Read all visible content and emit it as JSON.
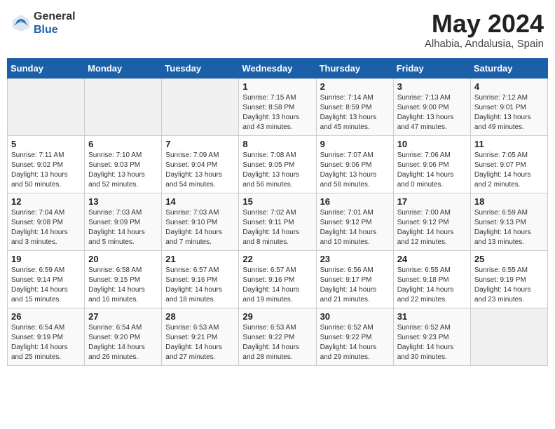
{
  "header": {
    "logo_general": "General",
    "logo_blue": "Blue",
    "month_title": "May 2024",
    "location": "Alhabia, Andalusia, Spain"
  },
  "days_of_week": [
    "Sunday",
    "Monday",
    "Tuesday",
    "Wednesday",
    "Thursday",
    "Friday",
    "Saturday"
  ],
  "weeks": [
    [
      {
        "day": "",
        "info": ""
      },
      {
        "day": "",
        "info": ""
      },
      {
        "day": "",
        "info": ""
      },
      {
        "day": "1",
        "info": "Sunrise: 7:15 AM\nSunset: 8:58 PM\nDaylight: 13 hours\nand 43 minutes."
      },
      {
        "day": "2",
        "info": "Sunrise: 7:14 AM\nSunset: 8:59 PM\nDaylight: 13 hours\nand 45 minutes."
      },
      {
        "day": "3",
        "info": "Sunrise: 7:13 AM\nSunset: 9:00 PM\nDaylight: 13 hours\nand 47 minutes."
      },
      {
        "day": "4",
        "info": "Sunrise: 7:12 AM\nSunset: 9:01 PM\nDaylight: 13 hours\nand 49 minutes."
      }
    ],
    [
      {
        "day": "5",
        "info": "Sunrise: 7:11 AM\nSunset: 9:02 PM\nDaylight: 13 hours\nand 50 minutes."
      },
      {
        "day": "6",
        "info": "Sunrise: 7:10 AM\nSunset: 9:03 PM\nDaylight: 13 hours\nand 52 minutes."
      },
      {
        "day": "7",
        "info": "Sunrise: 7:09 AM\nSunset: 9:04 PM\nDaylight: 13 hours\nand 54 minutes."
      },
      {
        "day": "8",
        "info": "Sunrise: 7:08 AM\nSunset: 9:05 PM\nDaylight: 13 hours\nand 56 minutes."
      },
      {
        "day": "9",
        "info": "Sunrise: 7:07 AM\nSunset: 9:06 PM\nDaylight: 13 hours\nand 58 minutes."
      },
      {
        "day": "10",
        "info": "Sunrise: 7:06 AM\nSunset: 9:06 PM\nDaylight: 14 hours\nand 0 minutes."
      },
      {
        "day": "11",
        "info": "Sunrise: 7:05 AM\nSunset: 9:07 PM\nDaylight: 14 hours\nand 2 minutes."
      }
    ],
    [
      {
        "day": "12",
        "info": "Sunrise: 7:04 AM\nSunset: 9:08 PM\nDaylight: 14 hours\nand 3 minutes."
      },
      {
        "day": "13",
        "info": "Sunrise: 7:03 AM\nSunset: 9:09 PM\nDaylight: 14 hours\nand 5 minutes."
      },
      {
        "day": "14",
        "info": "Sunrise: 7:03 AM\nSunset: 9:10 PM\nDaylight: 14 hours\nand 7 minutes."
      },
      {
        "day": "15",
        "info": "Sunrise: 7:02 AM\nSunset: 9:11 PM\nDaylight: 14 hours\nand 8 minutes."
      },
      {
        "day": "16",
        "info": "Sunrise: 7:01 AM\nSunset: 9:12 PM\nDaylight: 14 hours\nand 10 minutes."
      },
      {
        "day": "17",
        "info": "Sunrise: 7:00 AM\nSunset: 9:12 PM\nDaylight: 14 hours\nand 12 minutes."
      },
      {
        "day": "18",
        "info": "Sunrise: 6:59 AM\nSunset: 9:13 PM\nDaylight: 14 hours\nand 13 minutes."
      }
    ],
    [
      {
        "day": "19",
        "info": "Sunrise: 6:59 AM\nSunset: 9:14 PM\nDaylight: 14 hours\nand 15 minutes."
      },
      {
        "day": "20",
        "info": "Sunrise: 6:58 AM\nSunset: 9:15 PM\nDaylight: 14 hours\nand 16 minutes."
      },
      {
        "day": "21",
        "info": "Sunrise: 6:57 AM\nSunset: 9:16 PM\nDaylight: 14 hours\nand 18 minutes."
      },
      {
        "day": "22",
        "info": "Sunrise: 6:57 AM\nSunset: 9:16 PM\nDaylight: 14 hours\nand 19 minutes."
      },
      {
        "day": "23",
        "info": "Sunrise: 6:56 AM\nSunset: 9:17 PM\nDaylight: 14 hours\nand 21 minutes."
      },
      {
        "day": "24",
        "info": "Sunrise: 6:55 AM\nSunset: 9:18 PM\nDaylight: 14 hours\nand 22 minutes."
      },
      {
        "day": "25",
        "info": "Sunrise: 6:55 AM\nSunset: 9:19 PM\nDaylight: 14 hours\nand 23 minutes."
      }
    ],
    [
      {
        "day": "26",
        "info": "Sunrise: 6:54 AM\nSunset: 9:19 PM\nDaylight: 14 hours\nand 25 minutes."
      },
      {
        "day": "27",
        "info": "Sunrise: 6:54 AM\nSunset: 9:20 PM\nDaylight: 14 hours\nand 26 minutes."
      },
      {
        "day": "28",
        "info": "Sunrise: 6:53 AM\nSunset: 9:21 PM\nDaylight: 14 hours\nand 27 minutes."
      },
      {
        "day": "29",
        "info": "Sunrise: 6:53 AM\nSunset: 9:22 PM\nDaylight: 14 hours\nand 28 minutes."
      },
      {
        "day": "30",
        "info": "Sunrise: 6:52 AM\nSunset: 9:22 PM\nDaylight: 14 hours\nand 29 minutes."
      },
      {
        "day": "31",
        "info": "Sunrise: 6:52 AM\nSunset: 9:23 PM\nDaylight: 14 hours\nand 30 minutes."
      },
      {
        "day": "",
        "info": ""
      }
    ]
  ]
}
